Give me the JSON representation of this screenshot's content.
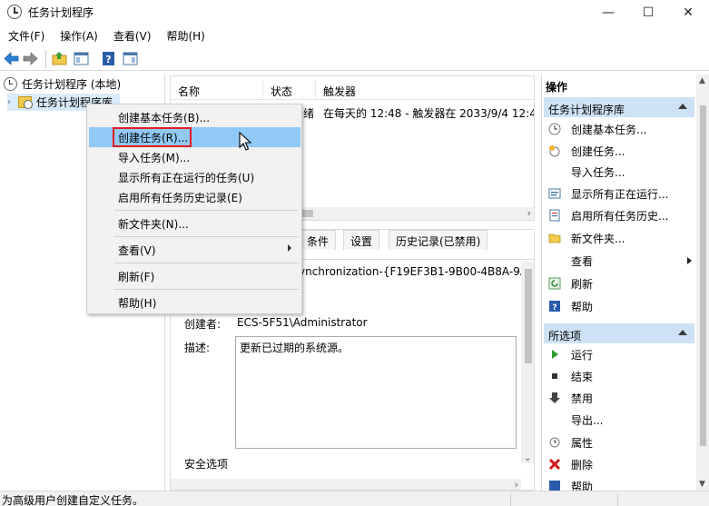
{
  "window": {
    "title": "任务计划程序",
    "controls": {
      "minimize": "—",
      "maximize": "☐",
      "close": "✕"
    }
  },
  "menu": [
    "文件(F)",
    "操作(A)",
    "查看(V)",
    "帮助(H)"
  ],
  "tree": {
    "root": "任务计划程序 (本地)",
    "child": "任务计划程序库"
  },
  "task_list": {
    "columns": [
      "名称",
      "状态",
      "触发器"
    ],
    "row_status_fragment": "绪",
    "row_trigger": "在每天的 12:48 - 触发器在 2033/9/4 12:4"
  },
  "details": {
    "tabs": [
      "条件",
      "设置",
      "历史记录(已禁用)"
    ],
    "location_fragment": "ynchronization-{F19EF3B1-9B00-4B8A-9A",
    "author_label": "创建者:",
    "author_value": "ECS-5F51\\Administrator",
    "desc_label": "描述:",
    "desc_value": "更新已过期的系统源。",
    "security_fragment": "安全选项"
  },
  "actions": {
    "title": "操作",
    "section1": "任务计划程序库",
    "items1": [
      "创建基本任务...",
      "创建任务...",
      "导入任务...",
      "显示所有正在运行...",
      "启用所有任务历史...",
      "新文件夹...",
      "查看",
      "刷新",
      "帮助"
    ],
    "section2": "所选项",
    "items2": [
      "运行",
      "结束",
      "禁用",
      "导出...",
      "属性",
      "删除",
      "帮助"
    ]
  },
  "context_menu": {
    "items": [
      "创建基本任务(B)...",
      "创建任务(R)...",
      "导入任务(M)...",
      "显示所有正在运行的任务(U)",
      "启用所有任务历史记录(E)",
      "新文件夹(N)...",
      "查看(V)",
      "刷新(F)",
      "帮助(H)"
    ]
  },
  "status": "为高级用户创建自定义任务。",
  "colors": {
    "selection": "#91c9f7",
    "highlight_box": "#e11b22",
    "section_header": "#cde2f4"
  }
}
